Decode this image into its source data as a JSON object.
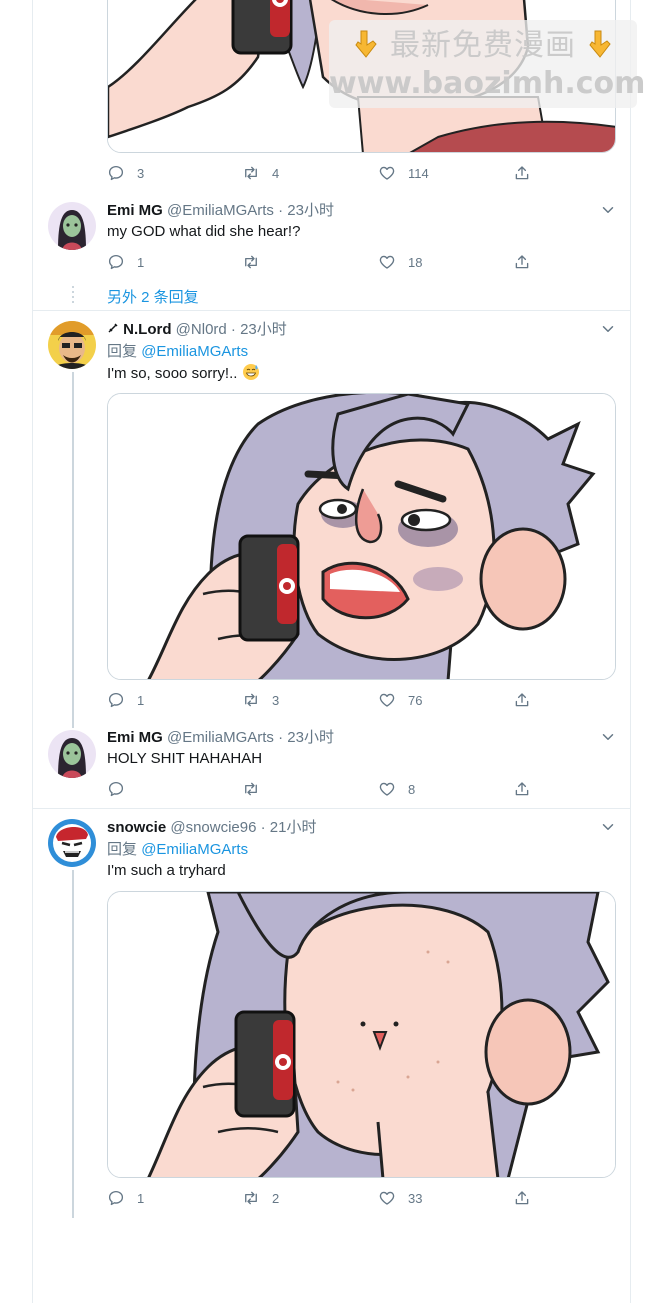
{
  "watermark": {
    "top": "最新免费漫画",
    "bottom": "www.baozimh.com"
  },
  "tweets": [
    {
      "actions": {
        "reply": "3",
        "retweet": "4",
        "like": "114"
      }
    },
    {
      "name": "Emi MG",
      "handle": "@EmiliaMGArts",
      "time": "· 23小时",
      "text": "my GOD what did she hear!?",
      "actions": {
        "reply": "1",
        "retweet": "",
        "like": "18"
      },
      "more_replies": "另外 2 条回复"
    },
    {
      "name": "N.Lord",
      "handle": "@Nl0rd",
      "time": "· 23小时",
      "reply_prefix": "回复",
      "reply_to": "@EmiliaMGArts",
      "text": "I'm so, sooo sorry!..",
      "actions": {
        "reply": "1",
        "retweet": "3",
        "like": "76"
      }
    },
    {
      "name": "Emi MG",
      "handle": "@EmiliaMGArts",
      "time": "· 23小时",
      "text": "HOLY SHIT HAHAHAH",
      "actions": {
        "reply": "",
        "retweet": "",
        "like": "8"
      }
    },
    {
      "name": "snowcie",
      "handle": "@snowcie96",
      "time": "· 21小时",
      "reply_prefix": "回复",
      "reply_to": "@EmiliaMGArts",
      "text": "I'm such a tryhard",
      "actions": {
        "reply": "1",
        "retweet": "2",
        "like": "33"
      }
    }
  ],
  "colors": {
    "link": "#1b95e0",
    "muted": "#657786",
    "hair": "#b7b3cf",
    "skin": "#fadad0"
  }
}
